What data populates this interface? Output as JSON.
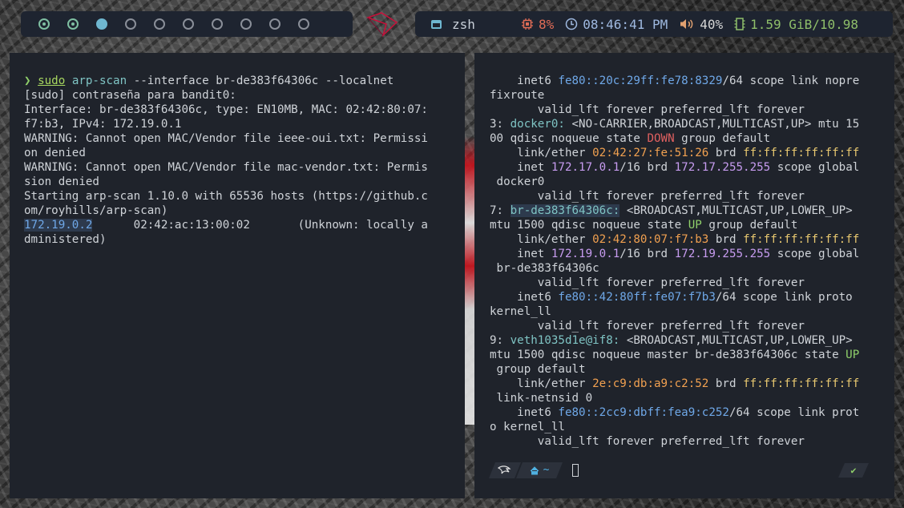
{
  "colors": {
    "bar_bg": "#1e2430",
    "pane_bg": "#1f232b",
    "workspace_active": "#6fb7d0",
    "workspace_occupied": "#7fbfa2",
    "cpu": "#e06c56",
    "clock": "#9fb9e0",
    "memory": "#8fbf6a"
  },
  "topbar": {
    "workspaces": [
      {
        "index": 1,
        "state": "occupied"
      },
      {
        "index": 2,
        "state": "occupied"
      },
      {
        "index": 3,
        "state": "active"
      },
      {
        "index": 4,
        "state": "empty"
      },
      {
        "index": 5,
        "state": "empty"
      },
      {
        "index": 6,
        "state": "empty"
      },
      {
        "index": 7,
        "state": "empty"
      },
      {
        "index": 8,
        "state": "empty"
      },
      {
        "index": 9,
        "state": "empty"
      },
      {
        "index": 10,
        "state": "empty"
      }
    ],
    "window_title": "zsh",
    "cpu": "8%",
    "clock": "08:46:41 PM",
    "volume": "40%",
    "memory": "1.59 GiB/10.98"
  },
  "left_pane": {
    "lines": [
      [
        {
          "t": "❯ ",
          "c": "c-green"
        },
        {
          "t": "sudo",
          "c": "c-lime u"
        },
        {
          "t": " "
        },
        {
          "t": "arp-scan",
          "c": "c-cyan"
        },
        {
          "t": " --interface br-de383f64306c --localnet"
        }
      ],
      [
        {
          "t": "[sudo] contraseña para bandit0:"
        }
      ],
      [
        {
          "t": "Interface: br-de383f64306c, type: EN10MB, MAC: 02:42:80:07:"
        }
      ],
      [
        {
          "t": "f7:b3, IPv4: 172.19.0.1"
        }
      ],
      [
        {
          "t": "WARNING: Cannot open MAC/Vendor file ieee-oui.txt: Permissi"
        }
      ],
      [
        {
          "t": "on denied"
        }
      ],
      [
        {
          "t": "WARNING: Cannot open MAC/Vendor file mac-vendor.txt: Permis"
        }
      ],
      [
        {
          "t": "sion denied"
        }
      ],
      [
        {
          "t": "Starting arp-scan 1.10.0 with 65536 hosts (https://github.c"
        }
      ],
      [
        {
          "t": "om/royhills/arp-scan)"
        }
      ],
      [
        {
          "t": "172.19.0.2",
          "c": "c-ipsel"
        },
        {
          "t": "      02:42:ac:13:00:02       (Unknown: locally a"
        }
      ],
      [
        {
          "t": "dministered)"
        }
      ]
    ]
  },
  "right_pane": {
    "lines": [
      [
        {
          "t": "    inet6 "
        },
        {
          "t": "fe80::20c:29ff:fe78:8329",
          "c": "c-blue"
        },
        {
          "t": "/64 scope link nopre"
        }
      ],
      [
        {
          "t": "fixroute"
        }
      ],
      [
        {
          "t": "       valid_lft forever preferred_lft forever"
        }
      ],
      [
        {
          "t": "3: "
        },
        {
          "t": "docker0:",
          "c": "c-cyan"
        },
        {
          "t": " <NO-CARRIER,BROADCAST,MULTICAST,UP> mtu 15"
        }
      ],
      [
        {
          "t": "00 qdisc noqueue state "
        },
        {
          "t": "DOWN",
          "c": "c-red"
        },
        {
          "t": " group default"
        }
      ],
      [
        {
          "t": "    link/ether "
        },
        {
          "t": "02:42:27:fe:51:26",
          "c": "c-orange"
        },
        {
          "t": " brd "
        },
        {
          "t": "ff:ff:ff:ff:ff:ff",
          "c": "c-yellow"
        }
      ],
      [
        {
          "t": "    inet "
        },
        {
          "t": "172.17.0.1",
          "c": "c-purple"
        },
        {
          "t": "/16 brd "
        },
        {
          "t": "172.17.255.255",
          "c": "c-purple"
        },
        {
          "t": " scope global"
        }
      ],
      [
        {
          "t": " docker0"
        }
      ],
      [
        {
          "t": "       valid_lft forever preferred_lft forever"
        }
      ],
      [
        {
          "t": "7: "
        },
        {
          "t": "br-de383f64306c:",
          "c": "c-cyan c-sel"
        },
        {
          "t": " <BROADCAST,MULTICAST,UP,LOWER_UP>"
        }
      ],
      [
        {
          "t": "mtu 1500 qdisc noqueue state "
        },
        {
          "t": "UP",
          "c": "c-green"
        },
        {
          "t": " group default"
        }
      ],
      [
        {
          "t": "    link/ether "
        },
        {
          "t": "02:42:80:07:f7:b3",
          "c": "c-orange"
        },
        {
          "t": " brd "
        },
        {
          "t": "ff:ff:ff:ff:ff:ff",
          "c": "c-yellow"
        }
      ],
      [
        {
          "t": "    inet "
        },
        {
          "t": "172.19.0.1",
          "c": "c-purple"
        },
        {
          "t": "/16 brd "
        },
        {
          "t": "172.19.255.255",
          "c": "c-purple"
        },
        {
          "t": " scope global"
        }
      ],
      [
        {
          "t": " br-de383f64306c"
        }
      ],
      [
        {
          "t": "       valid_lft forever preferred_lft forever"
        }
      ],
      [
        {
          "t": "    inet6 "
        },
        {
          "t": "fe80::42:80ff:fe07:f7b3",
          "c": "c-blue"
        },
        {
          "t": "/64 scope link proto"
        }
      ],
      [
        {
          "t": "kernel_ll"
        }
      ],
      [
        {
          "t": "       valid_lft forever preferred_lft forever"
        }
      ],
      [
        {
          "t": "9: "
        },
        {
          "t": "veth1035d1e@if8:",
          "c": "c-cyan"
        },
        {
          "t": " <BROADCAST,MULTICAST,UP,LOWER_UP>"
        }
      ],
      [
        {
          "t": "mtu 1500 qdisc noqueue master br-de383f64306c state "
        },
        {
          "t": "UP",
          "c": "c-green"
        }
      ],
      [
        {
          "t": " group default"
        }
      ],
      [
        {
          "t": "    link/ether "
        },
        {
          "t": "2e:c9:db:a9:c2:52",
          "c": "c-orange"
        },
        {
          "t": " brd "
        },
        {
          "t": "ff:ff:ff:ff:ff:ff",
          "c": "c-yellow"
        }
      ],
      [
        {
          "t": " link-netnsid 0"
        }
      ],
      [
        {
          "t": "    inet6 "
        },
        {
          "t": "fe80::2cc9:dbff:fea9:c252",
          "c": "c-blue"
        },
        {
          "t": "/64 scope link prot"
        }
      ],
      [
        {
          "t": "o kernel_ll"
        }
      ],
      [
        {
          "t": "       valid_lft forever preferred_lft forever"
        }
      ]
    ],
    "prompt": {
      "home_symbol": "~",
      "status_symbol": "✔"
    }
  }
}
